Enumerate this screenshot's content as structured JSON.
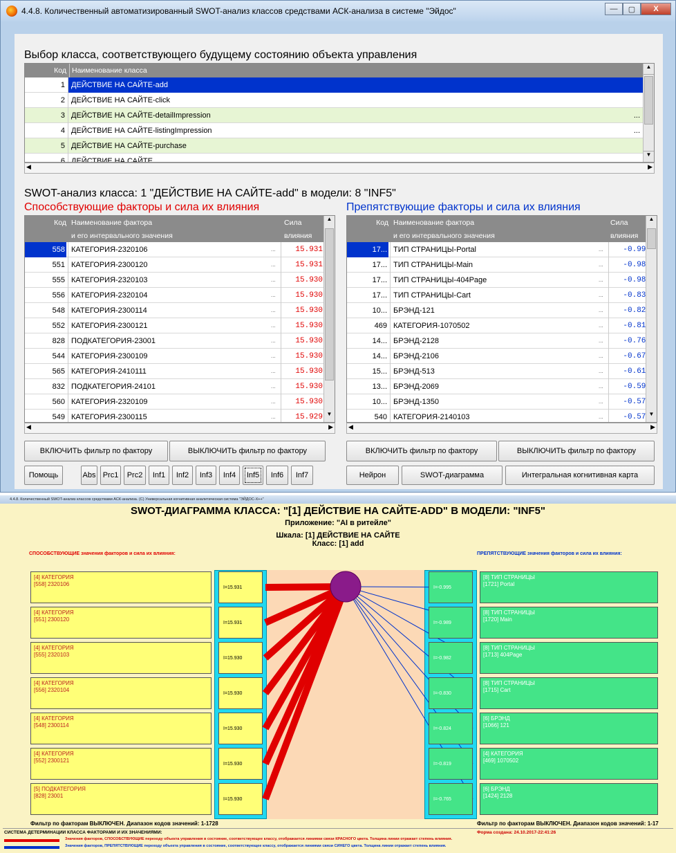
{
  "window1": {
    "title": "4.4.8. Количественный автоматизированный SWOT-анализ классов средствами АСК-анализа в системе \"Эйдос\"",
    "controls": {
      "minimize": "—",
      "maximize": "▢",
      "close": "X"
    }
  },
  "classes": {
    "heading": "Выбор класса, соответствующего будущему состоянию объекта управления",
    "col_code": "Код",
    "col_name": "Наименование класса",
    "rows": [
      {
        "code": "1",
        "name": "ДЕЙСТВИЕ НА САЙТЕ-add",
        "more": ""
      },
      {
        "code": "2",
        "name": "ДЕЙСТВИЕ НА САЙТЕ-click",
        "more": ""
      },
      {
        "code": "3",
        "name": "ДЕЙСТВИЕ НА САЙТЕ-detailImpression",
        "more": "..."
      },
      {
        "code": "4",
        "name": "ДЕЙСТВИЕ НА САЙТЕ-listingImpression",
        "more": "..."
      },
      {
        "code": "5",
        "name": "ДЕЙСТВИЕ НА САЙТЕ-purchase",
        "more": ""
      },
      {
        "code": "6",
        "name": "ДЕЙСТВИЕ НА САЙТЕ",
        "more": ""
      }
    ]
  },
  "swot": {
    "heading": "SWOT-анализ класса: 1 \"ДЕЙСТВИЕ НА САЙТЕ-add\" в модели: 8 \"INF5\"",
    "left_title": "Способствующие факторы и сила их влияния",
    "right_title": "Препятствующие факторы и сила их влияния",
    "col_code": "Код",
    "col_name1": "Наименование фактора",
    "col_name2": "и его интервального значения",
    "col_force1": "Сила",
    "col_force2": "влияния",
    "left_rows": [
      {
        "code": "558",
        "name": "КАТЕГОРИЯ-2320106",
        "val": "15.931"
      },
      {
        "code": "551",
        "name": "КАТЕГОРИЯ-2300120",
        "val": "15.931"
      },
      {
        "code": "555",
        "name": "КАТЕГОРИЯ-2320103",
        "val": "15.930"
      },
      {
        "code": "556",
        "name": "КАТЕГОРИЯ-2320104",
        "val": "15.930"
      },
      {
        "code": "548",
        "name": "КАТЕГОРИЯ-2300114",
        "val": "15.930"
      },
      {
        "code": "552",
        "name": "КАТЕГОРИЯ-2300121",
        "val": "15.930"
      },
      {
        "code": "828",
        "name": "ПОДКАТЕГОРИЯ-23001",
        "val": "15.930"
      },
      {
        "code": "544",
        "name": "КАТЕГОРИЯ-2300109",
        "val": "15.930"
      },
      {
        "code": "565",
        "name": "КАТЕГОРИЯ-2410111",
        "val": "15.930"
      },
      {
        "code": "832",
        "name": "ПОДКАТЕГОРИЯ-24101",
        "val": "15.930"
      },
      {
        "code": "560",
        "name": "КАТЕГОРИЯ-2320109",
        "val": "15.930"
      },
      {
        "code": "549",
        "name": "КАТЕГОРИЯ-2300115",
        "val": "15.929"
      }
    ],
    "right_rows": [
      {
        "code": "17...",
        "name": "ТИП СТРАНИЦЫ-Portal",
        "val": "-0.995"
      },
      {
        "code": "17...",
        "name": "ТИП СТРАНИЦЫ-Main",
        "val": "-0.989"
      },
      {
        "code": "17...",
        "name": "ТИП СТРАНИЦЫ-404Page",
        "val": "-0.982"
      },
      {
        "code": "17...",
        "name": "ТИП СТРАНИЦЫ-Cart",
        "val": "-0.830"
      },
      {
        "code": "10...",
        "name": "БРЭНД-121",
        "val": "-0.824"
      },
      {
        "code": "469",
        "name": "КАТЕГОРИЯ-1070502",
        "val": "-0.819"
      },
      {
        "code": "14...",
        "name": "БРЭНД-2128",
        "val": "-0.765"
      },
      {
        "code": "14...",
        "name": "БРЭНД-2106",
        "val": "-0.671"
      },
      {
        "code": "15...",
        "name": "БРЭНД-513",
        "val": "-0.615"
      },
      {
        "code": "13...",
        "name": "БРЭНД-2069",
        "val": "-0.592"
      },
      {
        "code": "10...",
        "name": "БРЭНД-1350",
        "val": "-0.577"
      },
      {
        "code": "540",
        "name": "КАТЕГОРИЯ-2140103",
        "val": "-0.571"
      }
    ],
    "dots": "..."
  },
  "buttons": {
    "filter_on": "ВКЛЮЧИТЬ фильтр по фактору",
    "filter_off": "ВЫКЛЮЧИТЬ фильтр по фактору",
    "help": "Помощь",
    "models": [
      "Abs",
      "Prc1",
      "Prc2",
      "Inf1",
      "Inf2",
      "Inf3",
      "Inf4",
      "Inf5",
      "Inf6",
      "Inf7"
    ],
    "neuron": "Нейрон",
    "swot_diagram": "SWOT-диаграмма",
    "cognitive_map": "Интегральная когнитивная карта"
  },
  "window2": {
    "title": "4.4.8. Количественный SWOT-анализ классов средствами АСК-анализа. (C) Универсальная когнитивная аналитическая система \"ЭЙДОС-Х++\"",
    "main_title": "SWOT-ДИАГРАММА КЛАССА: \"[1] ДЕЙСТВИЕ НА САЙТЕ-ADD\" В МОДЕЛИ: \"INF5\"",
    "app_line": "Приложение: \"AI в ритейле\"",
    "scale_line": "Шкала: [1] ДЕЙСТВИЕ НА САЙТЕ",
    "class_line": "Класс: [1] add",
    "left_header": "СПОСОБСТВУЮЩИЕ значения факторов и сила их влияния:",
    "right_header": "ПРЕПЯТСТВУЮЩИЕ значения факторов и сила их влияния:",
    "left_boxes": [
      {
        "l1": "[4] КАТЕГОРИЯ",
        "l2": "[558] 2320106",
        "i": "I=15.931"
      },
      {
        "l1": "[4] КАТЕГОРИЯ",
        "l2": "[551] 2300120",
        "i": "I=15.931"
      },
      {
        "l1": "[4] КАТЕГОРИЯ",
        "l2": "[555] 2320103",
        "i": "I=15.930"
      },
      {
        "l1": "[4] КАТЕГОРИЯ",
        "l2": "[556] 2320104",
        "i": "I=15.930"
      },
      {
        "l1": "[4] КАТЕГОРИЯ",
        "l2": "[548] 2300114",
        "i": "I=15.930"
      },
      {
        "l1": "[4] КАТЕГОРИЯ",
        "l2": "[552] 2300121",
        "i": "I=15.930"
      },
      {
        "l1": "[5] ПОДКАТЕГОРИЯ",
        "l2": "[828] 23001",
        "i": "I=15.930"
      }
    ],
    "right_boxes": [
      {
        "l1": "[8] ТИП СТРАНИЦЫ",
        "l2": "[1721] Portal",
        "i": "I=-0.995"
      },
      {
        "l1": "[8] ТИП СТРАНИЦЫ",
        "l2": "[1720] Main",
        "i": "I=-0.989"
      },
      {
        "l1": "[8] ТИП СТРАНИЦЫ",
        "l2": "[1713] 404Page",
        "i": "I=-0.982"
      },
      {
        "l1": "[8] ТИП СТРАНИЦЫ",
        "l2": "[1715] Cart",
        "i": "I=-0.830"
      },
      {
        "l1": "[6] БРЭНД",
        "l2": "[1066] 121",
        "i": "I=-0.824"
      },
      {
        "l1": "[4] КАТЕГОРИЯ",
        "l2": "[469] 1070502",
        "i": "I=-0.819"
      },
      {
        "l1": "[6] БРЭНД",
        "l2": "[1424] 2128",
        "i": "I=-0.765"
      }
    ],
    "filter_left": "Фильтр по факторам ВЫКЛЮЧЕН. Диапазон кодов значений: 1-1728",
    "filter_right": "Фильтр по факторам ВЫКЛЮЧЕН. Диапазон кодов значений: 1-17",
    "legend_title": "СИСТЕМА ДЕТЕРМИНАЦИИ КЛАССА ФАКТОРАМИ И ИХ ЗНАЧЕНИЯМИ:",
    "created": "Форма создана: 24.10.2017-22:41:26",
    "legend_red": "Значения факторов, СПОСОБСТВУЮЩИЕ переходу объекта управления в состояние, соответствующее классу, отображается линиями связи КРАСНОГО цвета. Толщина линии отражает степень влияния.",
    "legend_blue": "Значения факторов, ПРЕПЯТСТВУЮЩИЕ переходу объекта управления в состояние, соответствующее классу, отображается линиями связи СИНЕГО цвета. Толщина линии отражает степень влияния."
  },
  "colors": {
    "red": "#e00000",
    "blue": "#0033cc",
    "selection": "#0033cc"
  }
}
